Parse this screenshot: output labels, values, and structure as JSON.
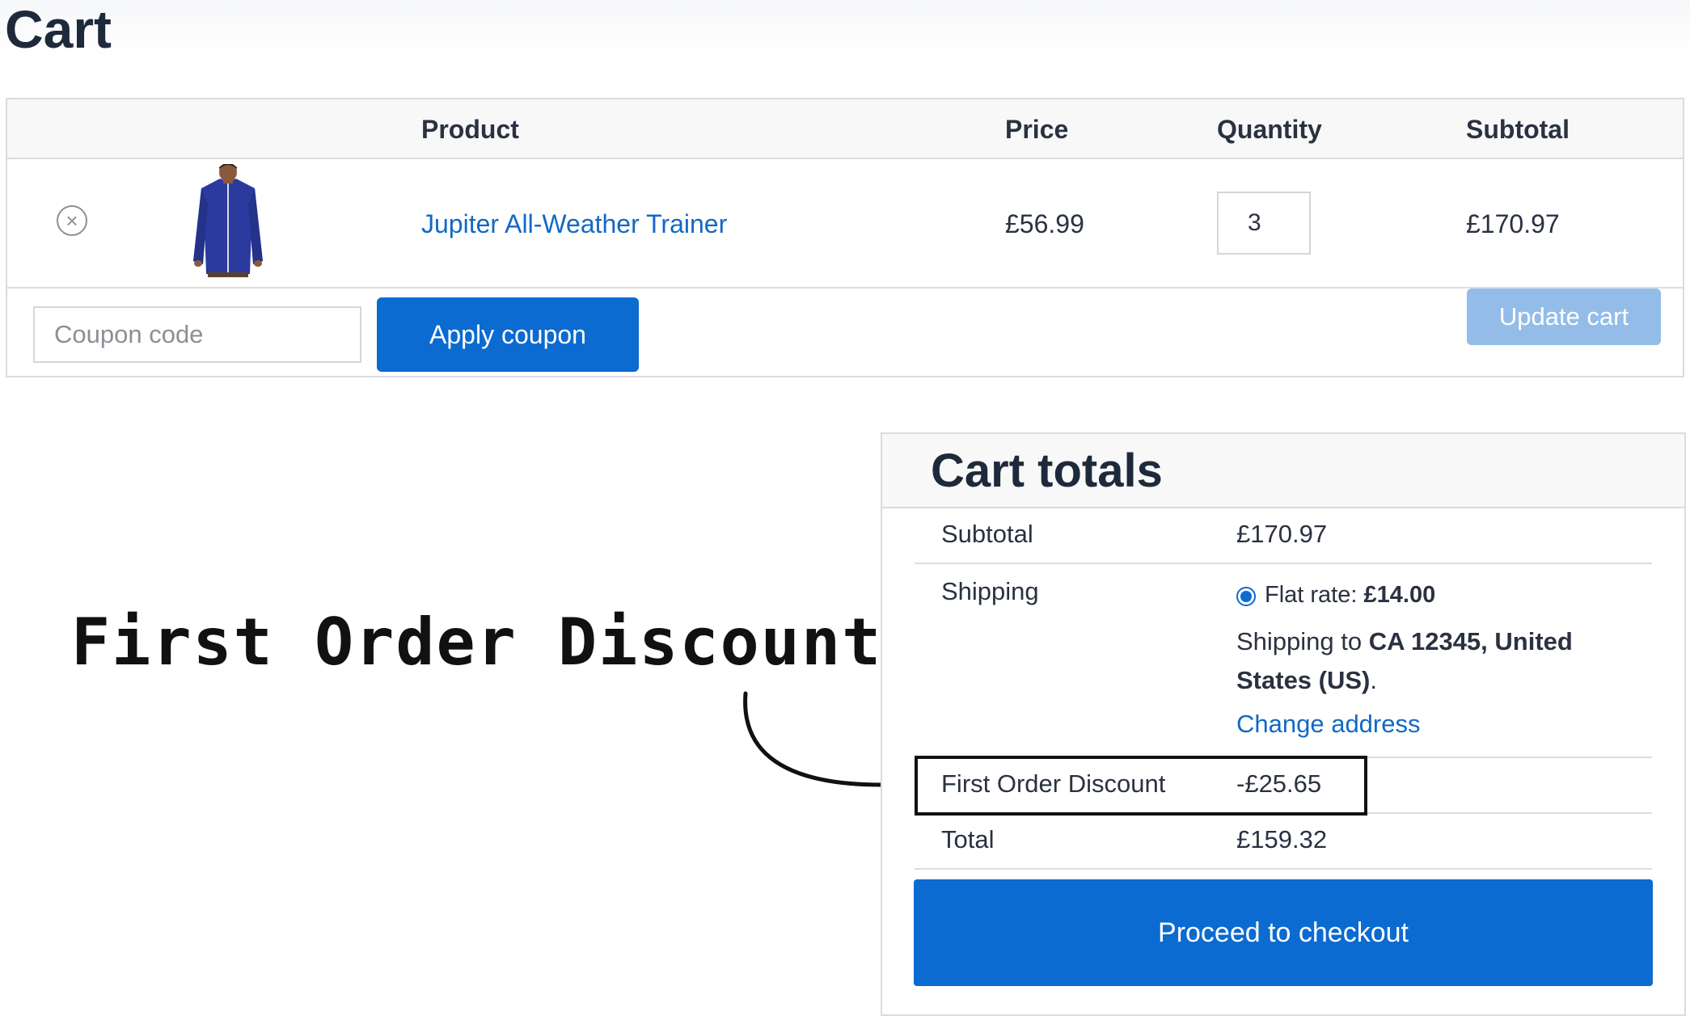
{
  "page": {
    "title": "Cart"
  },
  "cart_table": {
    "headers": {
      "product": "Product",
      "price": "Price",
      "quantity": "Quantity",
      "subtotal": "Subtotal"
    },
    "items": [
      {
        "remove_icon": "close-circle-icon",
        "thumbnail": "blue zip-up jacket",
        "name": "Jupiter All-Weather Trainer",
        "price": "£56.99",
        "quantity": "3",
        "subtotal": "£170.97"
      }
    ],
    "coupon_placeholder": "Coupon code",
    "apply_coupon_label": "Apply coupon",
    "update_cart_label": "Update cart"
  },
  "annotation": {
    "text": "First Order Discount"
  },
  "cart_totals": {
    "title": "Cart totals",
    "subtotal_label": "Subtotal",
    "subtotal_value": "£170.97",
    "shipping_label": "Shipping",
    "shipping_method_prefix": "Flat rate: ",
    "shipping_method_price": "£14.00",
    "shipping_to_prefix": "Shipping to ",
    "shipping_to_location": "CA 12345, United States (US)",
    "shipping_to_suffix": ".",
    "change_address_label": "Change address",
    "discount_label": "First Order Discount",
    "discount_value": "-£25.65",
    "total_label": "Total",
    "total_value": "£159.32",
    "checkout_label": "Proceed to checkout"
  },
  "colors": {
    "primary": "#0b6bd1",
    "link": "#1368c4",
    "disabled_button": "#93bce8",
    "heading": "#1e2a3b"
  }
}
